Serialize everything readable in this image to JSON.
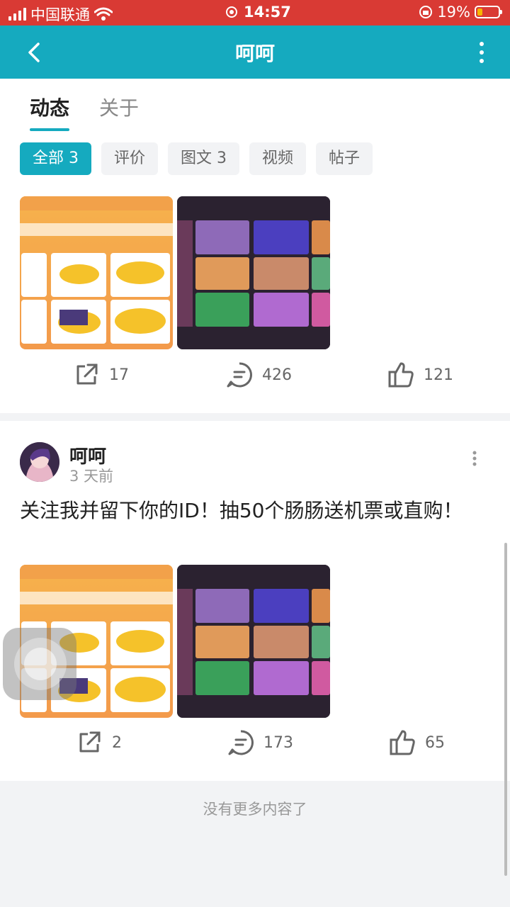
{
  "status": {
    "carrier": "中国联通",
    "time": "14:57",
    "battery": "19%",
    "battery_level": 0.19
  },
  "header": {
    "title": "呵呵"
  },
  "tabs": [
    {
      "label": "动态"
    },
    {
      "label": "关于"
    }
  ],
  "filters": [
    {
      "label": "全部 3"
    },
    {
      "label": "评价"
    },
    {
      "label": "图文 3"
    },
    {
      "label": "视频"
    },
    {
      "label": "帖子"
    }
  ],
  "post1": {
    "share": "17",
    "comment": "426",
    "like": "121"
  },
  "post2": {
    "author": "呵呵",
    "time": "3 天前",
    "text": "关注我并留下你的ID！抽50个肠肠送机票或直购！",
    "share": "2",
    "comment": "173",
    "like": "65"
  },
  "footer": {
    "no_more": "没有更多内容了"
  },
  "colors": {
    "accent": "#15aabf",
    "status_bar": "#d93a34"
  }
}
